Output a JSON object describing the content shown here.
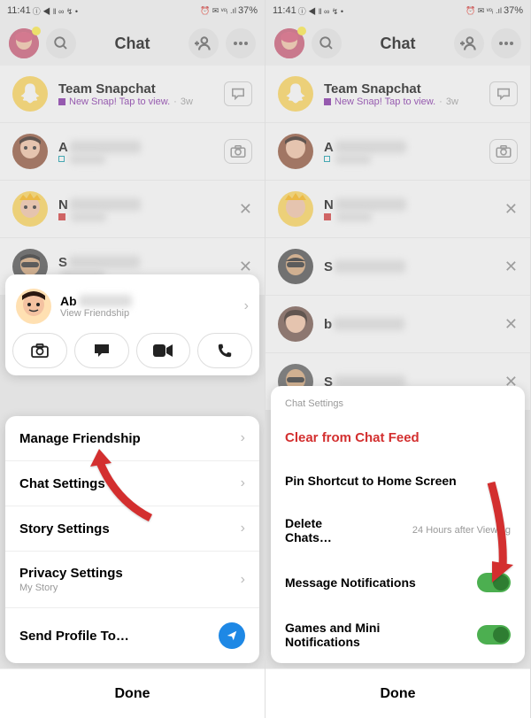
{
  "status": {
    "time": "11:41",
    "icons": "ⓘ ◀ ‖ ∞ ↯ •",
    "battery": "37%",
    "signal": "⏰ ✉ ᵛᵒᵢ .ıl"
  },
  "header": {
    "title": "Chat"
  },
  "chats": {
    "team": {
      "name": "Team Snapchat",
      "status": "New Snap! Tap to view.",
      "time": "3w"
    },
    "c1": {
      "name": "A"
    },
    "c2": {
      "name": "N"
    },
    "c3": {
      "name": "S"
    },
    "c4": {
      "name": "b"
    },
    "c5": {
      "name": "S"
    }
  },
  "sheet1": {
    "profile_name": "Ab",
    "profile_sub": "View Friendship",
    "menu": {
      "m1": "Manage Friendship",
      "m2": "Chat Settings",
      "m3": "Story Settings",
      "m4": "Privacy Settings",
      "m4_sub": "My Story",
      "m5": "Send Profile To…"
    }
  },
  "sheet2": {
    "title": "Chat Settings",
    "i1": "Clear from Chat Feed",
    "i2": "Pin Shortcut to Home Screen",
    "i3": "Delete Chats…",
    "i3_sub": "24 Hours after Viewing",
    "i4": "Message Notifications",
    "i5": "Games and Mini Notifications"
  },
  "done": "Done",
  "received": "Received · 1y"
}
